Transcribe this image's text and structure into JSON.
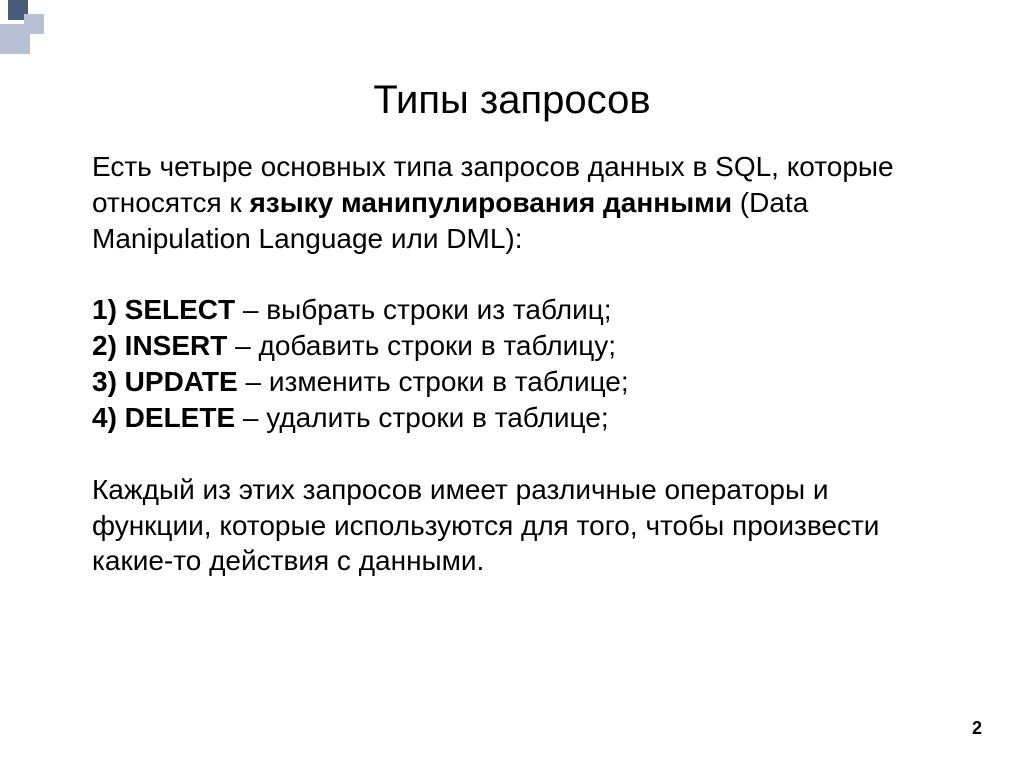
{
  "title": "Типы запросов",
  "intro": {
    "part1": "Есть четыре основных типа запросов данных в SQL, которые относятся к ",
    "bold1": "языку манипулирования данными",
    "part2": " (Data Manipulation Language или DML):"
  },
  "list": [
    {
      "numcmd": "1) SELECT",
      "desc": " – выбрать строки из таблиц;"
    },
    {
      "numcmd": "2) INSERT",
      "desc": " – добавить строки в таблицу;"
    },
    {
      "numcmd": "3) UPDATE",
      "desc": " – изменить строки в таблице;"
    },
    {
      "numcmd": "4) DELETE",
      "desc": " – удалить строки в таблице;"
    }
  ],
  "outro": "Каждый из этих запросов имеет различные операторы и функции, которые используются для того, чтобы произвести какие-то действия с данными.",
  "pageNumber": "2"
}
